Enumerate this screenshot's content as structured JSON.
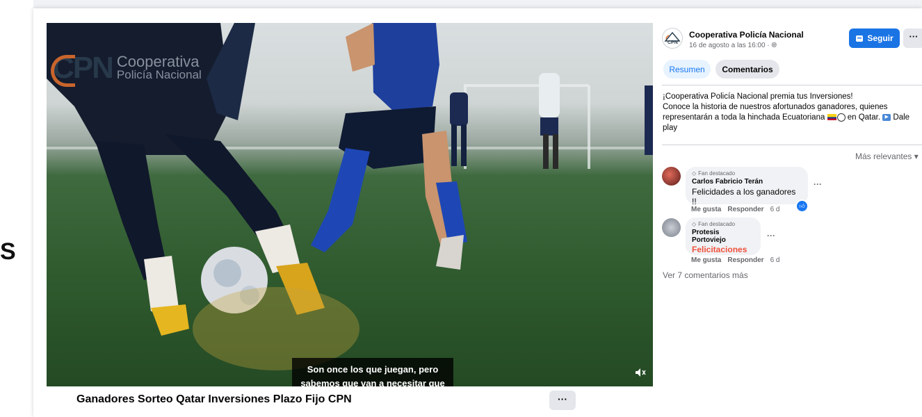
{
  "left_glyph": "S",
  "video": {
    "logo_short": "CPN",
    "logo_line1": "Cooperativa",
    "logo_line2": "Policía Nacional",
    "subtitle_line1": "Son once los que juegan, pero",
    "subtitle_line2": "sabemos que van a necesitar que",
    "title": "Ganadores Sorteo Qatar Inversiones Plazo Fijo CPN",
    "more_label": "···"
  },
  "post": {
    "page_name": "Cooperativa Policía Nacional",
    "date": "16 de agosto a las 16:00 · ",
    "follow_label": "Seguir",
    "more_label": "···",
    "tabs": [
      {
        "label": "Resumen",
        "active": true
      },
      {
        "label": "Comentarios",
        "active": false
      }
    ],
    "text_line1": "¡Cooperativa Policía Nacional premia tus Inversiones!",
    "text_line2": "Conoce la historia de nuestros afortunados ganadores, quienes",
    "text_line3a": "representarán a toda la hinchada Ecuatoriana ",
    "text_line3b": " en Qatar. ",
    "text_line3c": " Dale",
    "text_line4": "play"
  },
  "comments": {
    "sort_label": "Más relevantes",
    "items": [
      {
        "badge": "Fan destacado",
        "author": "Carlos Fabricio Terán",
        "text": "Felicidades a los ganadores !!",
        "like": "Me gusta",
        "reply": "Responder",
        "time": "6 d"
      },
      {
        "badge": "Fan destacado",
        "author": "Protesis Portoviejo",
        "text": "Felicitaciones",
        "like": "Me gusta",
        "reply": "Responder",
        "time": "6 d"
      }
    ],
    "more_comments": "Ver 7 comentarios más"
  },
  "colors": {
    "accent": "#1877f2",
    "follow_button": "#1b74e4",
    "highlight_text": "#f0513b"
  }
}
